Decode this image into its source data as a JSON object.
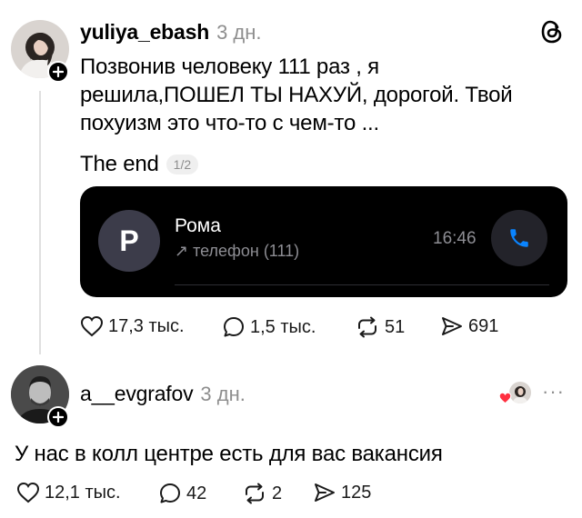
{
  "post": {
    "username": "yuliya_ebash",
    "time": "3 дн.",
    "text_lines": [
      "Позвонив человеку 111 раз , я",
      "решила,ПОШЕЛ ТЫ НАХУЙ, дорогой. Твой",
      "похуизм это что-то с чем-то ...",
      "The end"
    ],
    "page_indicator": "1/2",
    "call_card": {
      "caller_initial": "P",
      "caller_name": "Рома",
      "caller_subtitle": "↗ телефон (111)",
      "call_time": "16:46"
    },
    "actions": {
      "likes": "17,3 тыс.",
      "comments": "1,5 тыс.",
      "reposts": "51",
      "shares": "691"
    }
  },
  "reply": {
    "username": "a__evgrafov",
    "time": "3 дн.",
    "text": "У нас в колл центре есть для вас вакансия",
    "more": "···",
    "actions": {
      "likes": "12,1 тыс.",
      "comments": "42",
      "reposts": "2",
      "shares": "125"
    }
  },
  "colors": {
    "text": "#000000",
    "muted": "#8e8e8e",
    "card_bg": "#000000",
    "phone_icon": "#0a84ff",
    "heart_red": "#ff3040"
  },
  "icons": [
    "threads-logo-icon",
    "plus-icon",
    "phone-icon",
    "heart-icon",
    "comment-icon",
    "repost-icon",
    "share-icon",
    "liked-heart-icon"
  ]
}
